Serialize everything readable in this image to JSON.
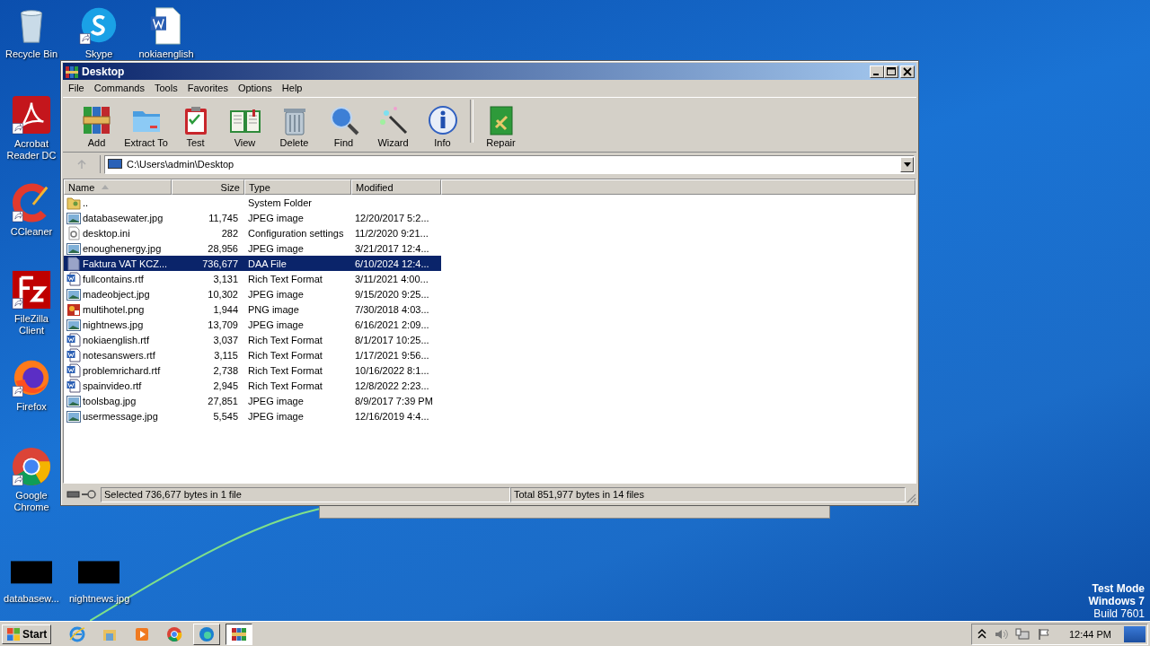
{
  "desktop_icons": [
    {
      "label": "Recycle Bin",
      "kind": "recycle",
      "shortcut": false
    },
    {
      "label": "Skype",
      "kind": "skype",
      "shortcut": true
    },
    {
      "label": "nokiaenglish",
      "kind": "word",
      "shortcut": false
    },
    {
      "label": "Acrobat Reader DC",
      "kind": "acrobat",
      "shortcut": true
    },
    {
      "label": "CCleaner",
      "kind": "ccleaner",
      "shortcut": true
    },
    {
      "label": "FileZilla Client",
      "kind": "filezilla",
      "shortcut": true
    },
    {
      "label": "Firefox",
      "kind": "firefox",
      "shortcut": true
    },
    {
      "label": "Google Chrome",
      "kind": "chrome",
      "shortcut": true
    },
    {
      "label": "databasew...",
      "kind": "thumb",
      "shortcut": false
    },
    {
      "label": "nightnews.jpg",
      "kind": "thumb",
      "shortcut": false
    }
  ],
  "window": {
    "title": "Desktop",
    "menu": [
      "File",
      "Commands",
      "Tools",
      "Favorites",
      "Options",
      "Help"
    ],
    "toolbar": [
      {
        "label": "Add",
        "kind": "add"
      },
      {
        "label": "Extract To",
        "kind": "extract"
      },
      {
        "label": "Test",
        "kind": "test"
      },
      {
        "label": "View",
        "kind": "view"
      },
      {
        "label": "Delete",
        "kind": "delete"
      },
      {
        "label": "Find",
        "kind": "find"
      },
      {
        "label": "Wizard",
        "kind": "wizard"
      },
      {
        "label": "Info",
        "kind": "info"
      },
      {
        "label": "Repair",
        "kind": "repair"
      }
    ],
    "address": "C:\\Users\\admin\\Desktop",
    "columns": [
      {
        "label": "Name",
        "sorted": true
      },
      {
        "label": "Size",
        "sorted": false
      },
      {
        "label": "Type",
        "sorted": false
      },
      {
        "label": "Modified",
        "sorted": false
      }
    ],
    "rows": [
      {
        "name": "..",
        "size": "",
        "type": "System Folder",
        "modified": "",
        "kind": "up",
        "selected": false
      },
      {
        "name": "databasewater.jpg",
        "size": "11,745",
        "type": "JPEG image",
        "modified": "12/20/2017 5:2...",
        "kind": "image",
        "selected": false
      },
      {
        "name": "desktop.ini",
        "size": "282",
        "type": "Configuration settings",
        "modified": "11/2/2020 9:21...",
        "kind": "ini",
        "selected": false
      },
      {
        "name": "enoughenergy.jpg",
        "size": "28,956",
        "type": "JPEG image",
        "modified": "3/21/2017 12:4...",
        "kind": "image",
        "selected": false
      },
      {
        "name": "Faktura VAT KCZ...",
        "size": "736,677",
        "type": "DAA File",
        "modified": "6/10/2024 12:4...",
        "kind": "file",
        "selected": true
      },
      {
        "name": "fullcontains.rtf",
        "size": "3,131",
        "type": "Rich Text Format",
        "modified": "3/11/2021 4:00...",
        "kind": "rtf",
        "selected": false
      },
      {
        "name": "madeobject.jpg",
        "size": "10,302",
        "type": "JPEG image",
        "modified": "9/15/2020 9:25...",
        "kind": "image",
        "selected": false
      },
      {
        "name": "multihotel.png",
        "size": "1,944",
        "type": "PNG image",
        "modified": "7/30/2018 4:03...",
        "kind": "png",
        "selected": false
      },
      {
        "name": "nightnews.jpg",
        "size": "13,709",
        "type": "JPEG image",
        "modified": "6/16/2021 2:09...",
        "kind": "image",
        "selected": false
      },
      {
        "name": "nokiaenglish.rtf",
        "size": "3,037",
        "type": "Rich Text Format",
        "modified": "8/1/2017 10:25...",
        "kind": "rtf",
        "selected": false
      },
      {
        "name": "notesanswers.rtf",
        "size": "3,115",
        "type": "Rich Text Format",
        "modified": "1/17/2021 9:56...",
        "kind": "rtf",
        "selected": false
      },
      {
        "name": "problemrichard.rtf",
        "size": "2,738",
        "type": "Rich Text Format",
        "modified": "10/16/2022 8:1...",
        "kind": "rtf",
        "selected": false
      },
      {
        "name": "spainvideo.rtf",
        "size": "2,945",
        "type": "Rich Text Format",
        "modified": "12/8/2022 2:23...",
        "kind": "rtf",
        "selected": false
      },
      {
        "name": "toolsbag.jpg",
        "size": "27,851",
        "type": "JPEG image",
        "modified": "8/9/2017 7:39 PM",
        "kind": "image",
        "selected": false
      },
      {
        "name": "usermessage.jpg",
        "size": "5,545",
        "type": "JPEG image",
        "modified": "12/16/2019 4:4...",
        "kind": "image",
        "selected": false
      }
    ],
    "status_bar": [
      "Selected 736,677 bytes in 1 file",
      "Total 851,977 bytes in 14 files"
    ]
  },
  "system_notice": [
    "Test Mode",
    "Windows 7",
    "Build 7601"
  ],
  "taskbar": {
    "start": "Start",
    "apps": [
      {
        "kind": "ie",
        "selected": false
      },
      {
        "kind": "explorer",
        "selected": false
      },
      {
        "kind": "media",
        "selected": false
      },
      {
        "kind": "chrome",
        "selected": false
      },
      {
        "kind": "edge",
        "selected": false
      },
      {
        "kind": "winrar",
        "selected": true
      }
    ],
    "clock": "12:44 PM"
  }
}
